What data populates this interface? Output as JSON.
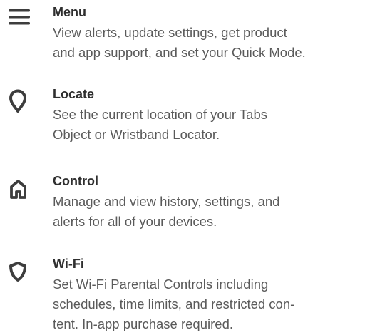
{
  "items": [
    {
      "icon": "menu-icon",
      "title": "Menu",
      "description": "View alerts, update settings, get product\nand app support, and set your Quick Mode."
    },
    {
      "icon": "location-pin-icon",
      "title": "Locate",
      "description": "See the current location of your Tabs\nObject or Wristband Locator."
    },
    {
      "icon": "home-icon",
      "title": "Control",
      "description": "Manage and view history, settings, and\nalerts for all of your devices."
    },
    {
      "icon": "shield-icon",
      "title": "Wi-Fi",
      "description": "Set Wi-Fi Parental Controls including\nschedules, time limits, and restricted con-\ntent. In-app purchase required."
    }
  ],
  "colors": {
    "icon": "#3d3d3d",
    "title": "#2f2f2f",
    "text": "#5a5a5a"
  }
}
